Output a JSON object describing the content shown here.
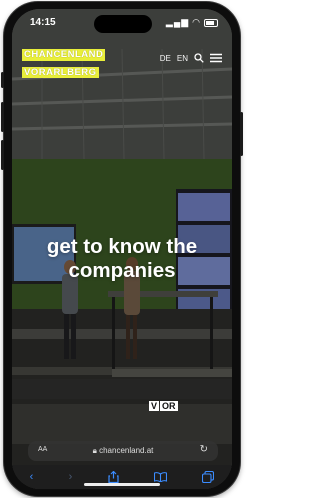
{
  "status_bar": {
    "time": "14:15"
  },
  "site": {
    "logo_line1": "CHANCENLAND",
    "logo_line2": "VORARLBERG",
    "lang_de": "DE",
    "lang_en": "EN",
    "hero_line1": "get to know the",
    "hero_line2": "companies",
    "sign_letters": [
      "V",
      "OR"
    ]
  },
  "browser": {
    "text_size": "AA",
    "url": "chancenland.at"
  },
  "colors": {
    "logo_highlight": "#e9ef3a",
    "link_blue": "#3b8cff"
  }
}
